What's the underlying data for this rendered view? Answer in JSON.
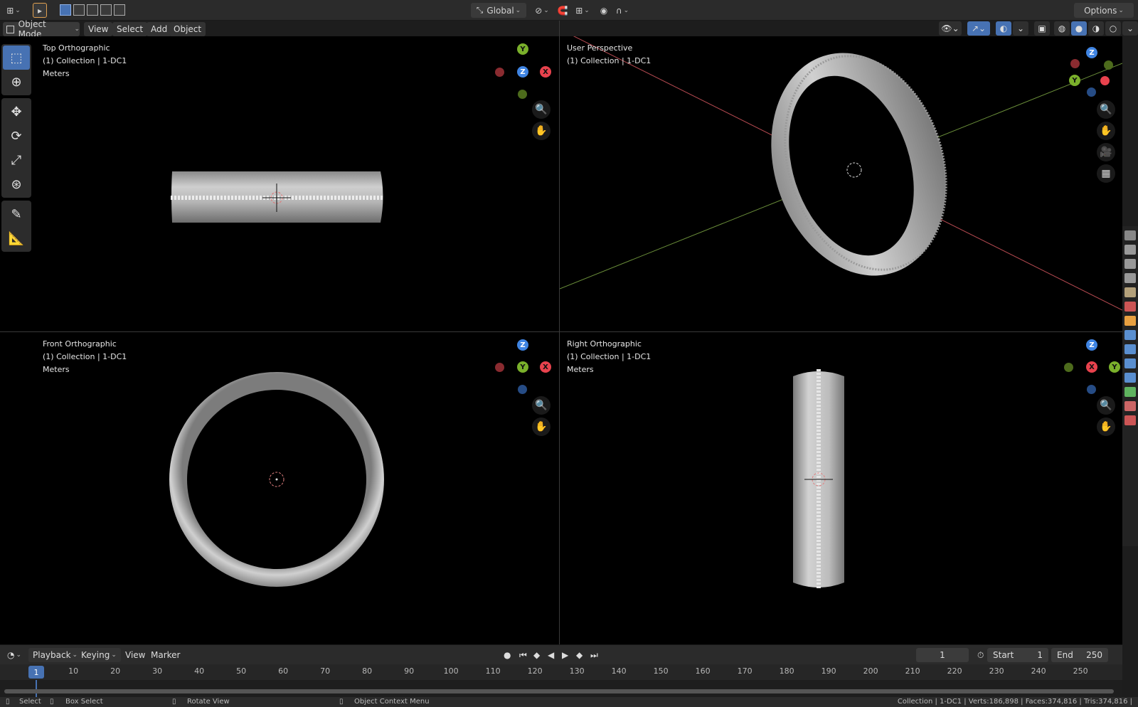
{
  "topbar": {
    "transform_orientation": "Global",
    "options": "Options"
  },
  "header": {
    "mode": "Object Mode",
    "menus": [
      "View",
      "Select",
      "Add",
      "Object"
    ]
  },
  "viewports": [
    {
      "title": "Top Orthographic",
      "collection": "(1) Collection | 1-DC1",
      "units": "Meters"
    },
    {
      "title": "User Perspective",
      "collection": "(1) Collection | 1-DC1",
      "units": ""
    },
    {
      "title": "Front Orthographic",
      "collection": "(1) Collection | 1-DC1",
      "units": "Meters"
    },
    {
      "title": "Right Orthographic",
      "collection": "(1) Collection | 1-DC1",
      "units": "Meters"
    }
  ],
  "gizmo_labels": {
    "x": "X",
    "y": "Y",
    "z": "Z"
  },
  "tools": [
    "select-box-icon",
    "cursor-icon",
    "move-icon",
    "rotate-icon",
    "scale-icon",
    "transform-icon",
    "annotate-icon",
    "measure-icon"
  ],
  "timeline": {
    "menus": [
      "Playback",
      "Keying",
      "View",
      "Marker"
    ],
    "current_frame": "1",
    "start_label": "Start",
    "start_value": "1",
    "end_label": "End",
    "end_value": "250",
    "ticks": [
      "10",
      "20",
      "30",
      "40",
      "50",
      "60",
      "70",
      "80",
      "90",
      "100",
      "110",
      "120",
      "130",
      "140",
      "150",
      "160",
      "170",
      "180",
      "190",
      "200",
      "210",
      "220",
      "230",
      "240",
      "250"
    ],
    "marker": "1"
  },
  "statusbar": {
    "select": "Select",
    "box_select": "Box Select",
    "rotate_view": "Rotate View",
    "context_menu": "Object Context Menu",
    "stats": "Collection | 1-DC1 | Verts:186,898 | Faces:374,816 | Tris:374,816 |"
  },
  "colors": {
    "accent": "#4772b3",
    "x_axis": "#e8424d",
    "y_axis": "#7ab02b",
    "z_axis": "#3f84e2"
  }
}
